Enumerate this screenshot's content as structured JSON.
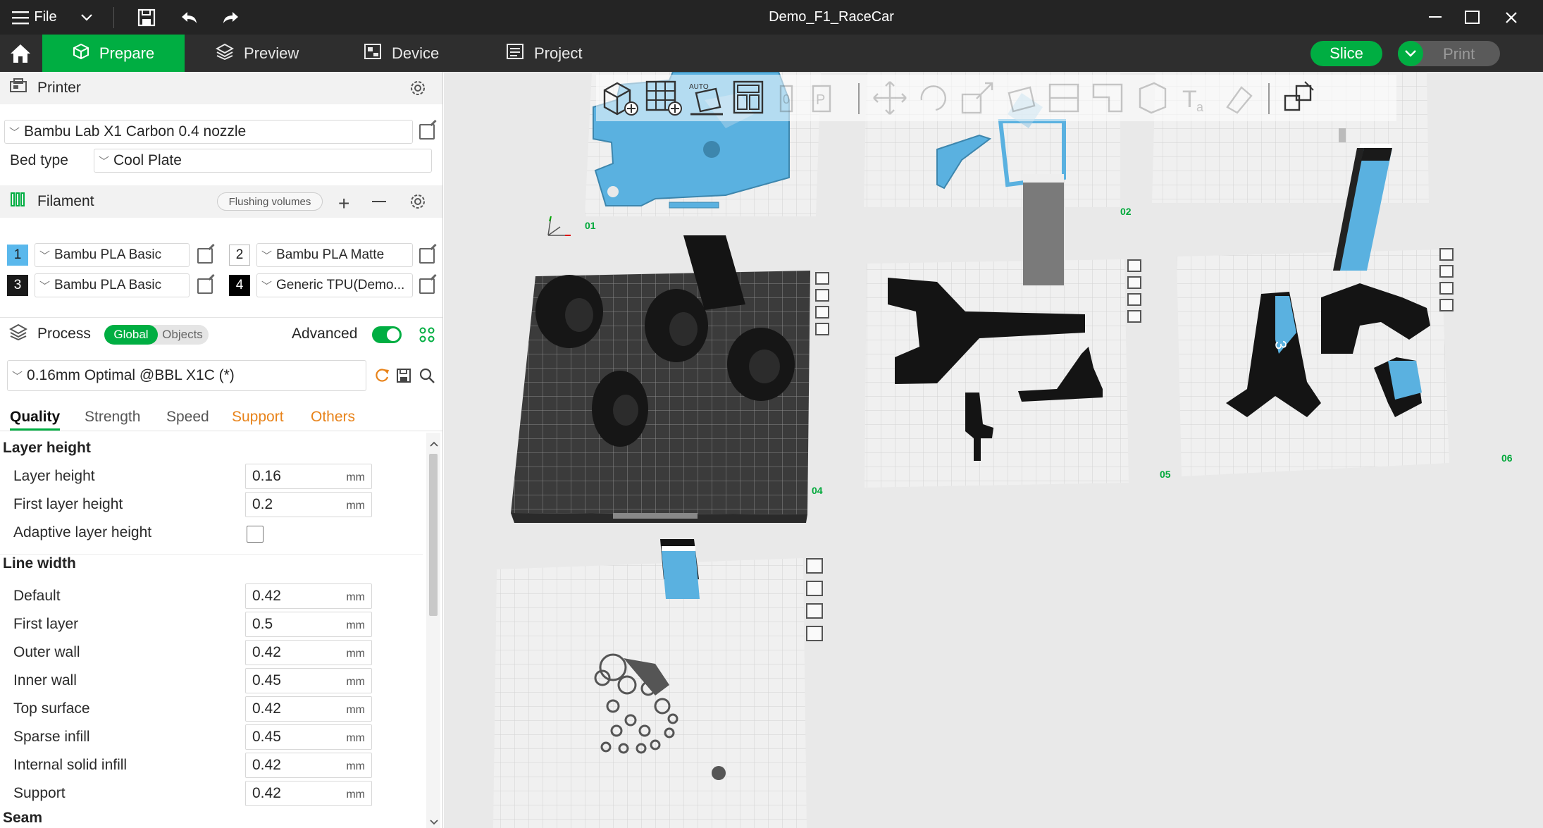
{
  "window": {
    "title": "Demo_F1_RaceCar",
    "file_menu": "File"
  },
  "tabs": {
    "prepare": "Prepare",
    "preview": "Preview",
    "device": "Device",
    "project": "Project"
  },
  "actions": {
    "slice": "Slice",
    "print": "Print"
  },
  "printer": {
    "section_title": "Printer",
    "selected": "Bambu Lab X1 Carbon 0.4 nozzle",
    "bed_type_label": "Bed type",
    "bed_type_value": "Cool Plate"
  },
  "filament": {
    "section_title": "Filament",
    "flushing_label": "Flushing volumes",
    "slots": [
      {
        "num": "1",
        "name": "Bambu PLA Basic",
        "color": "#5ab8ec"
      },
      {
        "num": "2",
        "name": "Bambu PLA Matte",
        "color": "#ffffff"
      },
      {
        "num": "3",
        "name": "Bambu PLA Basic",
        "color": "#1a1a1a"
      },
      {
        "num": "4",
        "name": "Generic TPU(Demo...",
        "color": "#000000"
      }
    ]
  },
  "process": {
    "section_title": "Process",
    "toggle_global": "Global",
    "toggle_objects": "Objects",
    "advanced_label": "Advanced",
    "preset": "0.16mm Optimal @BBL X1C (*)",
    "subtabs": [
      "Quality",
      "Strength",
      "Speed",
      "Support",
      "Others"
    ],
    "groups": {
      "layer_height": {
        "title": "Layer height",
        "layer_height": {
          "label": "Layer height",
          "value": "0.16",
          "unit": "mm"
        },
        "first_layer_height": {
          "label": "First layer height",
          "value": "0.2",
          "unit": "mm"
        },
        "adaptive": {
          "label": "Adaptive layer height"
        }
      },
      "line_width": {
        "title": "Line width",
        "rows": [
          {
            "label": "Default",
            "value": "0.42",
            "unit": "mm"
          },
          {
            "label": "First layer",
            "value": "0.5",
            "unit": "mm"
          },
          {
            "label": "Outer wall",
            "value": "0.42",
            "unit": "mm"
          },
          {
            "label": "Inner wall",
            "value": "0.45",
            "unit": "mm"
          },
          {
            "label": "Top surface",
            "value": "0.42",
            "unit": "mm"
          },
          {
            "label": "Sparse infill",
            "value": "0.45",
            "unit": "mm"
          },
          {
            "label": "Internal solid infill",
            "value": "0.42",
            "unit": "mm"
          },
          {
            "label": "Support",
            "value": "0.42",
            "unit": "mm"
          }
        ]
      },
      "seam": {
        "title": "Seam"
      }
    }
  },
  "plates": {
    "p1": "01",
    "p2": "02",
    "p4": "04",
    "p5": "05",
    "p6": "06"
  },
  "colors": {
    "accent": "#00ae42",
    "titlebar": "#242424",
    "tabbar": "#2e2e2e",
    "model_blue": "#5ab1e0",
    "model_black": "#161616",
    "tab_orange": "#e8831a"
  }
}
